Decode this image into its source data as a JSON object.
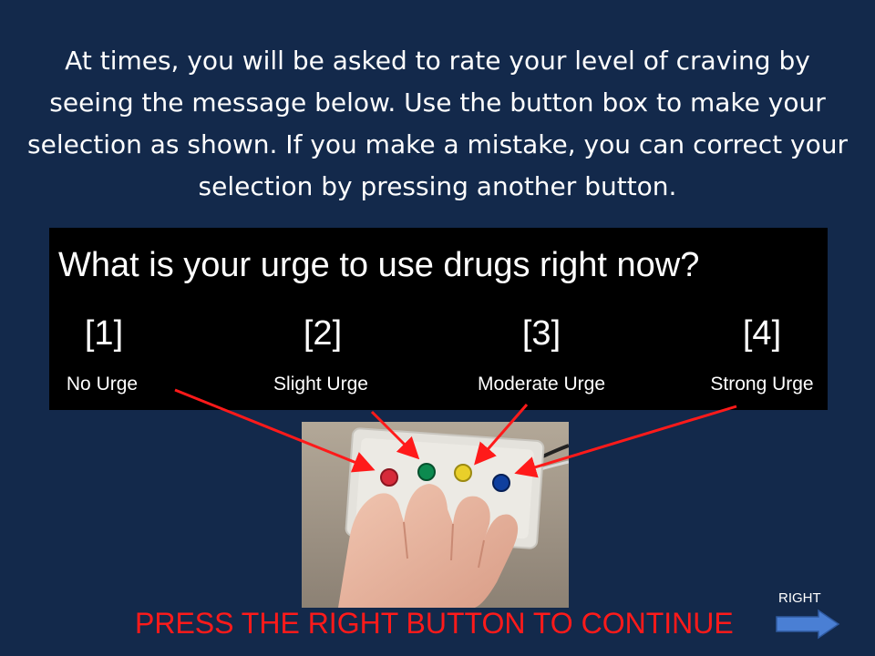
{
  "instructions": "At times, you will be asked to rate your level of craving by seeing the message below. Use the button box to make your selection as shown. If you make a mistake, you can correct your selection by pressing another button.",
  "prompt": {
    "question": "What is your urge to use drugs right now?",
    "options": [
      {
        "number": "[1]",
        "label": "No Urge",
        "button_color": "#d62b3a"
      },
      {
        "number": "[2]",
        "label": "Slight Urge",
        "button_color": "#0c8a4f"
      },
      {
        "number": "[3]",
        "label": "Moderate Urge",
        "button_color": "#e9cf2a"
      },
      {
        "number": "[4]",
        "label": "Strong Urge",
        "button_color": "#0f3f9e"
      }
    ]
  },
  "continue_text": "PRESS THE RIGHT BUTTON TO CONTINUE",
  "nav": {
    "right_label": "RIGHT",
    "icon": "right-arrow-icon"
  },
  "colors": {
    "background": "#13294b",
    "panel": "#000000",
    "continue_text": "#ff1a1a",
    "pointer_arrows": "#ff1a1a",
    "nav_arrow": "#4a7fd4"
  }
}
